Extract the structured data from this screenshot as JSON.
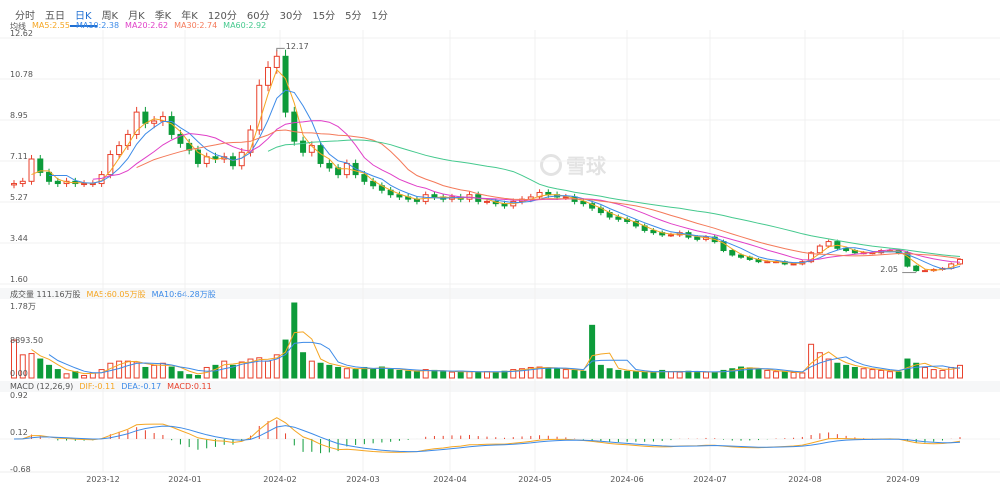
{
  "tabs": [
    "分时",
    "五日",
    "日K",
    "周K",
    "月K",
    "季K",
    "年K",
    "120分",
    "60分",
    "30分",
    "15分",
    "5分",
    "1分"
  ],
  "active_tab": 2,
  "ma_legend": {
    "label": "均线",
    "ma5": "MA5:2.55",
    "ma10": "MA10:2.38",
    "ma20": "MA20:2.62",
    "ma30": "MA30:2.74",
    "ma60": "MA60:2.92"
  },
  "price_axis": [
    "12.62",
    "10.78",
    "8.95",
    "7.11",
    "5.27",
    "3.44",
    "1.60"
  ],
  "max_label": "12.17",
  "min_label": "2.05",
  "volume_legend": {
    "label": "成交量 111.16万股",
    "ma5": "MA5:60.05万股",
    "ma10": "MA10:64.28万股"
  },
  "volume_axis": [
    "1.78万",
    "8893.50",
    "0.00"
  ],
  "macd_legend": {
    "label": "MACD (12,26,9)",
    "dif": "DIF:-0.11",
    "dea": "DEA:-0.17",
    "macd": "MACD:0.11"
  },
  "macd_axis": [
    "0.92",
    "0.12",
    "-0.68"
  ],
  "watermark": "雪球",
  "colors": {
    "up": "#e8412c",
    "down": "#0d9b3a",
    "ma5": "#f5a623",
    "ma10": "#3d8be8",
    "ma20": "#e040c8",
    "ma30": "#f47a5a",
    "ma60": "#45c98e",
    "dif": "#f5a623",
    "dea": "#3d8be8"
  },
  "chart_data": {
    "type": "candlestick",
    "x_labels": [
      "2023-12",
      "2024-01",
      "2024-02",
      "2024-03",
      "2024-04",
      "2024-05",
      "2024-06",
      "2024-07",
      "2024-08",
      "2024-09"
    ],
    "price_range": [
      1.6,
      12.62
    ],
    "volume_range": [
      0,
      17800
    ],
    "macd_range": [
      -0.68,
      0.92
    ],
    "close": [
      6.1,
      6.2,
      7.2,
      6.6,
      6.2,
      6.1,
      6.2,
      6.1,
      6.1,
      6.1,
      6.5,
      7.4,
      7.8,
      8.3,
      9.3,
      8.8,
      8.9,
      9.1,
      8.3,
      7.9,
      7.6,
      7.0,
      7.3,
      7.2,
      7.3,
      6.9,
      7.5,
      8.5,
      10.5,
      11.3,
      11.8,
      9.3,
      8.0,
      7.5,
      7.8,
      7.0,
      6.8,
      6.5,
      7.0,
      6.5,
      6.2,
      6.0,
      5.8,
      5.6,
      5.5,
      5.4,
      5.3,
      5.6,
      5.5,
      5.4,
      5.5,
      5.4,
      5.6,
      5.3,
      5.3,
      5.2,
      5.1,
      5.3,
      5.4,
      5.5,
      5.7,
      5.6,
      5.5,
      5.5,
      5.3,
      5.2,
      5.0,
      4.8,
      4.6,
      4.5,
      4.4,
      4.2,
      4.0,
      3.9,
      3.8,
      3.8,
      3.9,
      3.7,
      3.6,
      3.7,
      3.5,
      3.1,
      2.9,
      2.8,
      2.7,
      2.6,
      2.6,
      2.6,
      2.5,
      2.5,
      2.6,
      3.0,
      3.3,
      3.5,
      3.2,
      3.1,
      3.0,
      3.0,
      3.0,
      3.1,
      3.1,
      3.0,
      2.4,
      2.2,
      2.2,
      2.25,
      2.3,
      2.5,
      2.7
    ],
    "volume": [
      9000,
      5500,
      5800,
      4500,
      3000,
      2000,
      1000,
      1500,
      600,
      1200,
      2000,
      3500,
      4000,
      4000,
      3800,
      2500,
      3000,
      3500,
      2600,
      1500,
      800,
      600,
      2500,
      3000,
      4000,
      3000,
      3800,
      4500,
      4800,
      4000,
      5500,
      9000,
      17800,
      6000,
      4000,
      3500,
      3000,
      2500,
      2200,
      2000,
      2500,
      2200,
      2600,
      2000,
      1800,
      1600,
      1500,
      2000,
      1800,
      1500,
      1400,
      1600,
      1500,
      1300,
      1500,
      1400,
      1600,
      2000,
      2200,
      2500,
      2600,
      2400,
      2200,
      2000,
      1800,
      1600,
      12500,
      3000,
      2200,
      1800,
      1600,
      1500,
      1400,
      1300,
      1800,
      1500,
      1400,
      1600,
      1500,
      1400,
      1300,
      1800,
      2200,
      2600,
      2400,
      2000,
      1800,
      1500,
      1400,
      1300,
      1200,
      8000,
      6000,
      4500,
      3500,
      3000,
      2500,
      2200,
      2000,
      1800,
      1500,
      1400,
      4500,
      3500,
      2500,
      2000,
      1800,
      2500,
      3000
    ]
  }
}
